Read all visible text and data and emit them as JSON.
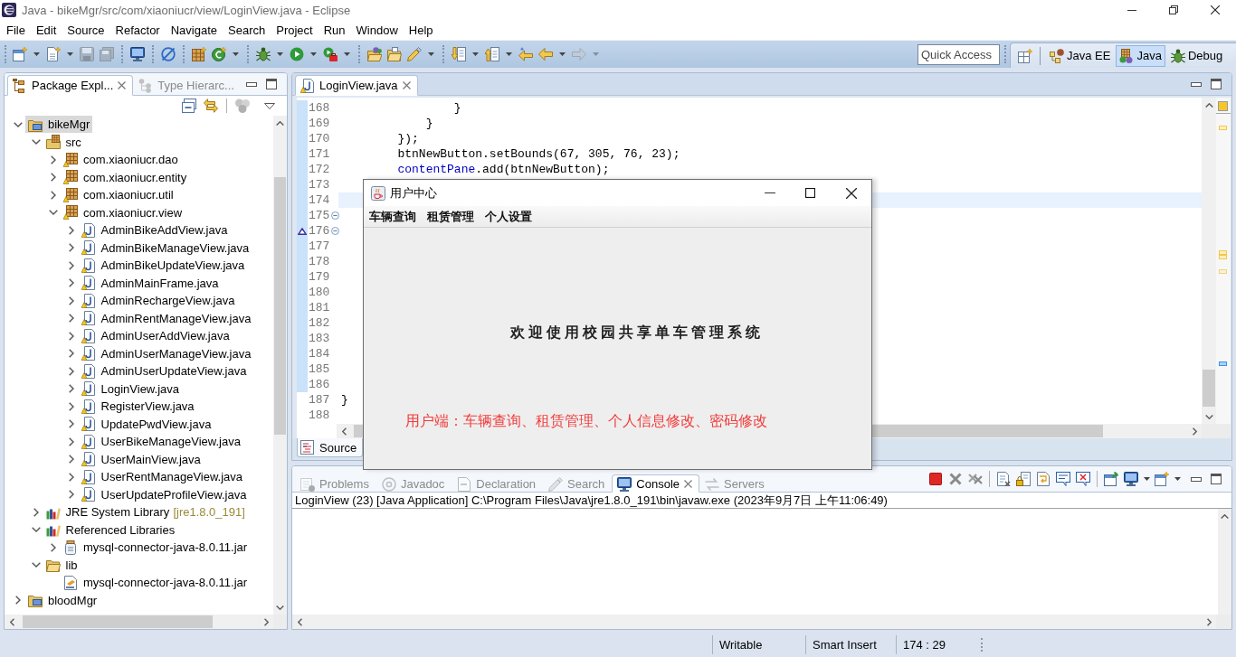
{
  "window": {
    "title": "Java - bikeMgr/src/com/xiaoniucr/view/LoginView.java - Eclipse"
  },
  "menu": [
    "File",
    "Edit",
    "Source",
    "Refactor",
    "Navigate",
    "Search",
    "Project",
    "Run",
    "Window",
    "Help"
  ],
  "toolbar": [
    [
      {
        "kind": "new",
        "dropdown": true,
        "disabled": false
      },
      {
        "kind": "new-file",
        "dropdown": true,
        "disabled": false
      },
      {
        "kind": "save",
        "dropdown": false,
        "disabled": true
      },
      {
        "kind": "save-all",
        "dropdown": false,
        "disabled": true
      }
    ],
    [
      {
        "kind": "terminal",
        "dropdown": false,
        "disabled": false
      }
    ],
    [
      {
        "kind": "skip",
        "dropdown": false,
        "disabled": false
      }
    ],
    [
      {
        "kind": "package",
        "dropdown": false,
        "disabled": false
      },
      {
        "kind": "class",
        "dropdown": true,
        "disabled": false
      }
    ],
    [
      {
        "kind": "debug",
        "dropdown": true,
        "disabled": false
      },
      {
        "kind": "run",
        "dropdown": true,
        "disabled": false
      },
      {
        "kind": "run-ext",
        "dropdown": true,
        "disabled": false
      }
    ],
    [
      {
        "kind": "open-type",
        "dropdown": false,
        "disabled": false
      },
      {
        "kind": "open-task",
        "dropdown": false,
        "disabled": false
      },
      {
        "kind": "search",
        "dropdown": true,
        "disabled": false
      }
    ],
    [
      {
        "kind": "next",
        "dropdown": true,
        "disabled": false
      },
      {
        "kind": "prev",
        "dropdown": true,
        "disabled": false
      },
      {
        "kind": "last-edit",
        "dropdown": false,
        "disabled": false
      },
      {
        "kind": "back",
        "dropdown": true,
        "disabled": false
      },
      {
        "kind": "forward",
        "dropdown": true,
        "disabled": true
      }
    ]
  ],
  "quick_access": {
    "placeholder": "Quick Access"
  },
  "perspectives": [
    {
      "kind": "javaee",
      "label": "Java EE",
      "selected": false
    },
    {
      "kind": "java",
      "label": "Java",
      "selected": true
    },
    {
      "kind": "debug",
      "label": "Debug",
      "selected": false
    }
  ],
  "package_explorer": {
    "tabs": [
      {
        "kind": "package",
        "label": "Package Expl...",
        "selected": true
      },
      {
        "kind": "hierarchy",
        "label": "Type Hierarc...",
        "selected": false
      }
    ],
    "tree": [
      {
        "label": "bikeMgr",
        "kind": "project",
        "expanded": true,
        "selected": true,
        "children": [
          {
            "label": "src",
            "kind": "srcfolder",
            "expanded": true,
            "selected": false,
            "children": [
              {
                "label": "com.xiaoniucr.dao",
                "kind": "package",
                "expanded": false,
                "selected": false
              },
              {
                "label": "com.xiaoniucr.entity",
                "kind": "package",
                "expanded": false,
                "selected": false
              },
              {
                "label": "com.xiaoniucr.util",
                "kind": "package",
                "expanded": false,
                "selected": false
              },
              {
                "label": "com.xiaoniucr.view",
                "kind": "package",
                "expanded": true,
                "selected": false,
                "children": [
                  {
                    "label": "AdminBikeAddView.java",
                    "kind": "java",
                    "expanded": false,
                    "selected": false
                  },
                  {
                    "label": "AdminBikeManageView.java",
                    "kind": "java",
                    "expanded": false,
                    "selected": false
                  },
                  {
                    "label": "AdminBikeUpdateView.java",
                    "kind": "java",
                    "expanded": false,
                    "selected": false
                  },
                  {
                    "label": "AdminMainFrame.java",
                    "kind": "java",
                    "expanded": false,
                    "selected": false
                  },
                  {
                    "label": "AdminRechargeView.java",
                    "kind": "java",
                    "expanded": false,
                    "selected": false
                  },
                  {
                    "label": "AdminRentManageView.java",
                    "kind": "java",
                    "expanded": false,
                    "selected": false
                  },
                  {
                    "label": "AdminUserAddView.java",
                    "kind": "java",
                    "expanded": false,
                    "selected": false
                  },
                  {
                    "label": "AdminUserManageView.java",
                    "kind": "java",
                    "expanded": false,
                    "selected": false
                  },
                  {
                    "label": "AdminUserUpdateView.java",
                    "kind": "java",
                    "expanded": false,
                    "selected": false
                  },
                  {
                    "label": "LoginView.java",
                    "kind": "java",
                    "expanded": false,
                    "selected": false
                  },
                  {
                    "label": "RegisterView.java",
                    "kind": "java",
                    "expanded": false,
                    "selected": false
                  },
                  {
                    "label": "UpdatePwdView.java",
                    "kind": "java",
                    "expanded": false,
                    "selected": false
                  },
                  {
                    "label": "UserBikeManageView.java",
                    "kind": "java",
                    "expanded": false,
                    "selected": false
                  },
                  {
                    "label": "UserMainView.java",
                    "kind": "java",
                    "expanded": false,
                    "selected": false
                  },
                  {
                    "label": "UserRentManageView.java",
                    "kind": "java",
                    "expanded": false,
                    "selected": false
                  },
                  {
                    "label": "UserUpdateProfileView.java",
                    "kind": "java",
                    "expanded": false,
                    "selected": false
                  }
                ]
              }
            ]
          },
          {
            "label": "JRE System Library",
            "decoration": "[jre1.8.0_191]",
            "kind": "library",
            "expanded": false,
            "selected": false
          },
          {
            "label": "Referenced Libraries",
            "kind": "library",
            "expanded": true,
            "selected": false,
            "children": [
              {
                "label": "mysql-connector-java-8.0.11.jar",
                "kind": "jar",
                "expanded": false,
                "selected": false
              }
            ]
          },
          {
            "label": "lib",
            "kind": "folder",
            "expanded": true,
            "selected": false,
            "children": [
              {
                "label": "mysql-connector-java-8.0.11.jar",
                "kind": "jarfile",
                "selected": false
              }
            ]
          }
        ]
      },
      {
        "label": "bloodMgr",
        "kind": "project",
        "expanded": false,
        "selected": false
      }
    ]
  },
  "editor": {
    "tabs": [
      {
        "label": "LoginView.java",
        "selected": true
      }
    ],
    "lines": [
      {
        "number": "168",
        "code": [
          {
            "kind": "plain",
            "text": "                }"
          }
        ],
        "current": false,
        "fold": false,
        "override": false,
        "in_range": true
      },
      {
        "number": "169",
        "code": [
          {
            "kind": "plain",
            "text": "            }"
          }
        ],
        "current": false,
        "fold": false,
        "override": false,
        "in_range": true
      },
      {
        "number": "170",
        "code": [
          {
            "kind": "plain",
            "text": "        });"
          }
        ],
        "current": false,
        "fold": false,
        "override": false,
        "in_range": true
      },
      {
        "number": "171",
        "code": [
          {
            "kind": "plain",
            "text": "        btnNewButton.setBounds(67, 305, 76, 23);"
          }
        ],
        "current": false,
        "fold": false,
        "override": false,
        "in_range": true
      },
      {
        "number": "172",
        "code": [
          {
            "kind": "field",
            "text": "        contentPane"
          },
          {
            "kind": "plain",
            "text": ".add(btnNewButton);"
          }
        ],
        "current": false,
        "fold": false,
        "override": false,
        "in_range": true
      },
      {
        "number": "173",
        "current": false,
        "fold": false,
        "override": false,
        "in_range": true
      },
      {
        "number": "174",
        "current": true,
        "fold": false,
        "override": false,
        "in_range": true
      },
      {
        "number": "175",
        "current": false,
        "fold": true,
        "override": false,
        "in_range": true
      },
      {
        "number": "176",
        "current": false,
        "fold": true,
        "override": true,
        "in_range": true
      },
      {
        "number": "177",
        "current": false,
        "fold": false,
        "override": false,
        "in_range": true
      },
      {
        "number": "178",
        "current": false,
        "fold": false,
        "override": false,
        "in_range": true
      },
      {
        "number": "179",
        "current": false,
        "fold": false,
        "override": false,
        "in_range": true
      },
      {
        "number": "180",
        "current": false,
        "fold": false,
        "override": false,
        "in_range": true
      },
      {
        "number": "181",
        "current": false,
        "fold": false,
        "override": false,
        "in_range": true
      },
      {
        "number": "182",
        "current": false,
        "fold": false,
        "override": false,
        "in_range": true
      },
      {
        "number": "183",
        "current": false,
        "fold": false,
        "override": false,
        "in_range": true
      },
      {
        "number": "184",
        "current": false,
        "fold": false,
        "override": false,
        "in_range": true
      },
      {
        "number": "185",
        "current": false,
        "fold": false,
        "override": false,
        "in_range": true
      },
      {
        "number": "186",
        "current": false,
        "fold": false,
        "override": false,
        "in_range": true
      },
      {
        "number": "187",
        "code": [
          {
            "kind": "plain",
            "text": "}"
          }
        ],
        "current": false,
        "fold": false,
        "override": false,
        "in_range": false
      },
      {
        "number": "188",
        "current": false,
        "fold": false,
        "override": false,
        "in_range": false
      }
    ],
    "bottom_tabs": [
      {
        "label": "Source",
        "selected": true
      }
    ]
  },
  "console": {
    "tabs": [
      {
        "kind": "problems",
        "label": "Problems",
        "selected": false
      },
      {
        "kind": "javadoc",
        "label": "Javadoc",
        "selected": false
      },
      {
        "kind": "declaration",
        "label": "Declaration",
        "selected": false
      },
      {
        "kind": "search",
        "label": "Search",
        "selected": false
      },
      {
        "kind": "console",
        "label": "Console",
        "selected": true
      },
      {
        "kind": "servers",
        "label": "Servers",
        "selected": false
      }
    ],
    "toolbar": [
      [
        {
          "kind": "terminate",
          "dropdown": false
        },
        {
          "kind": "remove",
          "dropdown": false
        },
        {
          "kind": "remove-all",
          "dropdown": false
        }
      ],
      [
        {
          "kind": "clear",
          "dropdown": false
        },
        {
          "kind": "scroll-lock",
          "dropdown": false
        },
        {
          "kind": "word-wrap",
          "dropdown": false
        },
        {
          "kind": "stdout",
          "dropdown": false
        },
        {
          "kind": "stderr",
          "dropdown": false
        }
      ],
      [
        {
          "kind": "pin",
          "dropdown": false
        },
        {
          "kind": "display",
          "dropdown": true
        },
        {
          "kind": "open-console",
          "dropdown": true
        }
      ]
    ],
    "process": "LoginView (23) [Java Application] C:\\Program Files\\Java\\jre1.8.0_191\\bin\\javaw.exe (2023年9月7日 上午11:06:49)"
  },
  "status_bar": [
    "Writable",
    "Smart Insert",
    "174 : 29"
  ],
  "dialog": {
    "title": "用户中心",
    "menu": [
      "车辆查询",
      "租赁管理",
      "个人设置"
    ],
    "welcome": "欢迎使用校园共享单车管理系统",
    "features": "用户端：车辆查询、租赁管理、个人信息修改、密码修改"
  }
}
